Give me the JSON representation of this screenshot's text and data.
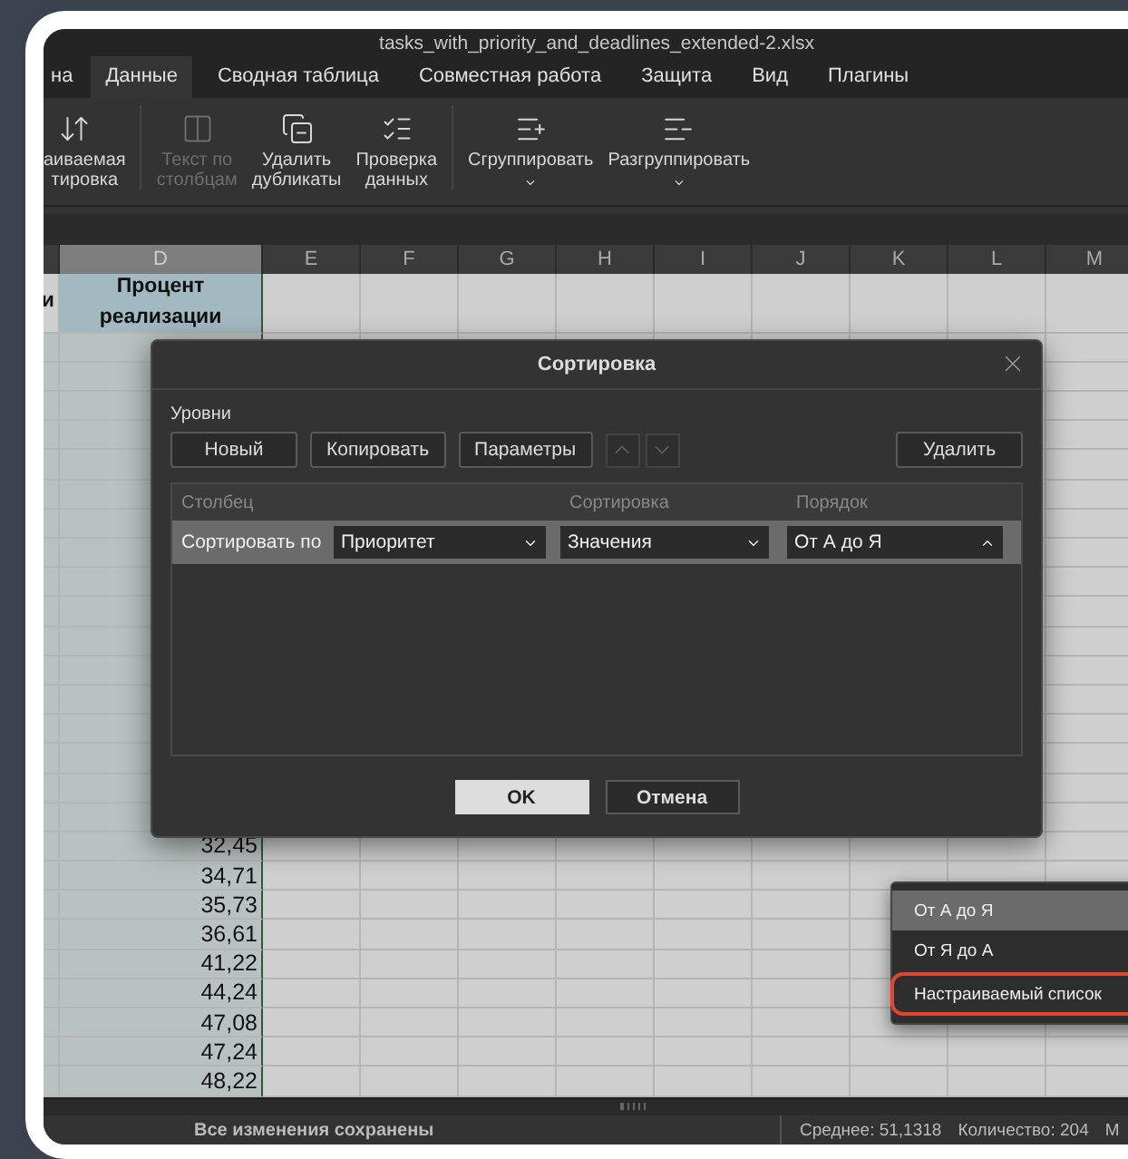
{
  "window": {
    "title": "tasks_with_priority_and_deadlines_extended-2.xlsx"
  },
  "tabs": [
    {
      "label": "на",
      "selected": false
    },
    {
      "label": "Данные",
      "selected": true
    },
    {
      "label": "Сводная таблица",
      "selected": false
    },
    {
      "label": "Совместная работа",
      "selected": false
    },
    {
      "label": "Защита",
      "selected": false
    },
    {
      "label": "Вид",
      "selected": false
    },
    {
      "label": "Плагины",
      "selected": false
    }
  ],
  "ribbon": {
    "groups": [
      [
        {
          "kind": "sort",
          "label": "аиваемая\nтировка",
          "disabled": false,
          "dropdown": false
        }
      ],
      [
        {
          "kind": "text-columns",
          "label": "Текст по\nстолбцам",
          "disabled": true,
          "dropdown": false
        },
        {
          "kind": "duplicates",
          "label": "Удалить\nдубликаты",
          "disabled": false,
          "dropdown": false
        },
        {
          "kind": "validation",
          "label": "Проверка\nданных",
          "disabled": false,
          "dropdown": false
        }
      ],
      [
        {
          "kind": "group",
          "label": "Сгруппировать",
          "disabled": false,
          "dropdown": true
        },
        {
          "kind": "ungroup",
          "label": "Разгруппировать",
          "disabled": false,
          "dropdown": true
        }
      ]
    ]
  },
  "sheet": {
    "columns": [
      {
        "label": "D",
        "selected": true
      },
      {
        "label": "E",
        "selected": false
      },
      {
        "label": "F",
        "selected": false
      },
      {
        "label": "G",
        "selected": false
      },
      {
        "label": "H",
        "selected": false
      },
      {
        "label": "I",
        "selected": false
      },
      {
        "label": "J",
        "selected": false
      },
      {
        "label": "K",
        "selected": false
      },
      {
        "label": "L",
        "selected": false
      },
      {
        "label": "M",
        "selected": false
      }
    ],
    "header_row": {
      "column_1": "и",
      "percent_header": "Процент реализации"
    },
    "values": [
      "32,45",
      "34,71",
      "35,73",
      "36,61",
      "41,22",
      "44,24",
      "47,08",
      "47,24",
      "48,22"
    ]
  },
  "dialog": {
    "title": "Сортировка",
    "section_label": "Уровни",
    "buttons": [
      "Новый",
      "Копировать",
      "Параметры"
    ],
    "delete_button": "Удалить",
    "columns": [
      "Столбец",
      "Сортировка",
      "Порядок"
    ],
    "levels": [
      {
        "label": "Сортировать по",
        "column": "Приоритет",
        "sort_on": "Значения",
        "order": "От А до Я",
        "order_expanded": true
      }
    ],
    "order_options": [
      {
        "label": "От А до Я",
        "selected": true,
        "highlighted": false
      },
      {
        "label": "От Я до А",
        "selected": false,
        "highlighted": false
      },
      {
        "label": "Настраиваемый список",
        "selected": false,
        "highlighted": true
      }
    ],
    "ok": "OK",
    "cancel": "Отмена"
  },
  "status_bar": {
    "message": "Все изменения сохранены",
    "average": "Среднее: 51,1318",
    "count": "Количество: 204",
    "column_3": "М"
  }
}
